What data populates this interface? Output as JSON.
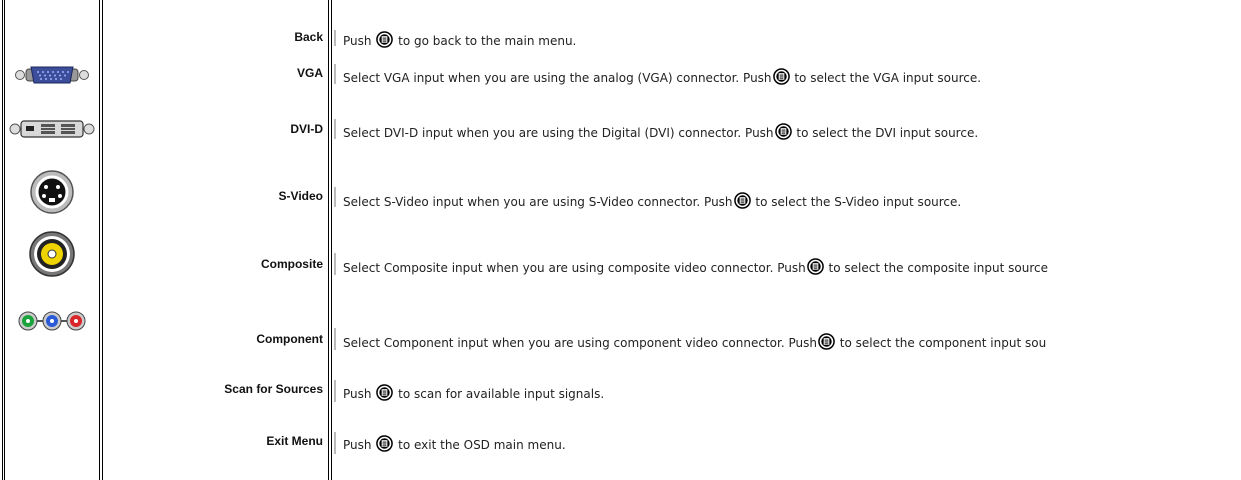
{
  "rows": [
    {
      "label": "Back",
      "pre": "Push ",
      "post": " to go back to the main menu.",
      "icon": "none"
    },
    {
      "label": "VGA",
      "pre": "Select VGA input when you are using the analog (VGA) connector. Push",
      "post": " to select the VGA input source.",
      "icon": "vga-connector-icon"
    },
    {
      "label": "DVI-D",
      "pre": "Select DVI-D input when you are using the Digital (DVI) connector. Push",
      "post": " to select the DVI input source.",
      "icon": "dvi-connector-icon"
    },
    {
      "label": "S-Video",
      "pre": "Select S-Video input when you are using S-Video connector. Push",
      "post": " to select the S-Video input source.",
      "icon": "svideo-connector-icon"
    },
    {
      "label": "Composite",
      "pre": "Select Composite input when you are using composite video connector. Push",
      "post": " to select the composite input source",
      "icon": "composite-connector-icon"
    },
    {
      "label": "Component",
      "pre": "Select Component input when you are using component video connector. Push",
      "post": " to select the component input sou",
      "icon": "component-connector-icon"
    },
    {
      "label": "Scan for Sources",
      "pre": "Push ",
      "post": " to scan for available input signals.",
      "icon": "none"
    },
    {
      "label": "Exit Menu",
      "pre": "Push ",
      "post": " to exit the OSD main menu.",
      "icon": "none"
    }
  ],
  "colors": {
    "rule": "#000000",
    "text": "#222222",
    "label": "#111111"
  }
}
